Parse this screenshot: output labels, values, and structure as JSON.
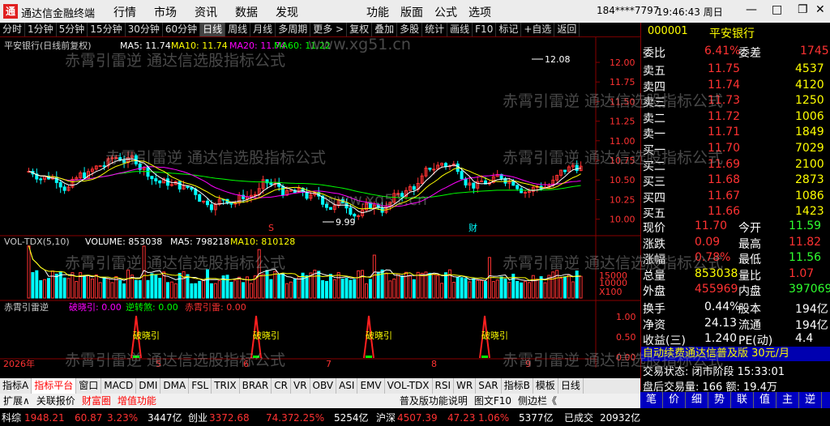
{
  "app": {
    "name": "通达信金融终端",
    "menu1": [
      "行情",
      "市场",
      "资讯",
      "数据",
      "发现"
    ],
    "menu2": [
      "功能",
      "版面",
      "公式",
      "选项"
    ],
    "user": "184****7797",
    "clock": "19:46:43 周日"
  },
  "toolbar": [
    "分时",
    "1分钟",
    "5分钟",
    "15分钟",
    "30分钟",
    "60分钟",
    "日线",
    "周线",
    "月线",
    "多周期",
    "更多 >",
    "复权",
    "叠加",
    "多股",
    "统计",
    "画线",
    "F10",
    "标记",
    "+自选",
    "返回"
  ],
  "chart": {
    "header": {
      "title": "平安银行(日线前复权)",
      "ma5": "MA5: 11.74",
      "ma10": "MA10: 11.74",
      "ma20": "MA20: 11.74",
      "ma60": "MA60: 11.22"
    },
    "price_ticks": [
      "12.00",
      "11.75",
      "11.50",
      "11.25",
      "11.00",
      "10.75",
      "10.50",
      "10.25",
      "10.00"
    ],
    "hi_label": "12.08",
    "lo_label": "9.99",
    "vol_header": {
      "name": "VOL-TDX(5,10)",
      "vol": "VOLUME: 853038",
      "ma5": "MA5: 798218",
      "ma10": "MA10: 810128"
    },
    "vol_ticks": [
      "15000",
      "10000",
      "5000",
      "X100"
    ],
    "ind_header": {
      "name": "赤霄引雷逆",
      "a": "破晓引: 0.00",
      "b": "逆转煞: 0.00",
      "c": "赤霄引雷: 0.00"
    },
    "ind_ticks": [
      "1.00",
      "0.50",
      "0.00"
    ],
    "signal_label": "破晓引",
    "date_labels": [
      "2026年",
      "5",
      "6",
      "7",
      "8",
      "9"
    ],
    "marker_s": "S",
    "marker_cai": "财"
  },
  "chart_data": {
    "type": "candlestick",
    "title": "平安银行(日线前复权)",
    "y_range": [
      9.99,
      12.08
    ],
    "high": 12.08,
    "low": 9.99,
    "ma": {
      "MA5": 11.74,
      "MA10": 11.74,
      "MA20": 11.74,
      "MA60": 11.22
    },
    "volume_last": 853038,
    "vol_ma5": 798218,
    "vol_ma10": 810128
  },
  "bottomtabs": [
    "指标A",
    "指标平台",
    "窗口",
    "MACD",
    "DMI",
    "DMA",
    "FSL",
    "TRIX",
    "BRAR",
    "CR",
    "VR",
    "OBV",
    "ASI",
    "EMV",
    "VOL-TDX",
    "RSI",
    "WR",
    "SAR",
    "指标B",
    "模板",
    "日线"
  ],
  "bottom2": [
    "扩展∧",
    "关联报价",
    "财富圈",
    "增值功能",
    "普及版功能说明",
    "图文F10",
    "侧边栏《"
  ],
  "quote": {
    "code": "000001",
    "name": "平安银行",
    "weibi_l": "委比",
    "weibi": "6.41%",
    "weicha_l": "委差",
    "weicha": "1745",
    "sell": [
      {
        "l": "卖五",
        "p": "11.75",
        "v": "4537"
      },
      {
        "l": "卖四",
        "p": "11.74",
        "v": "4120"
      },
      {
        "l": "卖三",
        "p": "11.73",
        "v": "1250"
      },
      {
        "l": "卖二",
        "p": "11.72",
        "v": "1006"
      },
      {
        "l": "卖一",
        "p": "11.71",
        "v": "1849"
      }
    ],
    "buy": [
      {
        "l": "买一",
        "p": "11.70",
        "v": "7029"
      },
      {
        "l": "买二",
        "p": "11.69",
        "v": "2100"
      },
      {
        "l": "买三",
        "p": "11.68",
        "v": "2873"
      },
      {
        "l": "买四",
        "p": "11.67",
        "v": "1086"
      },
      {
        "l": "买五",
        "p": "11.66",
        "v": "1423"
      }
    ],
    "stats": [
      {
        "l1": "现价",
        "v1": "11.70",
        "l2": "今开",
        "v2": "11.59",
        "c1": "red",
        "c2": "grn"
      },
      {
        "l1": "涨跌",
        "v1": "0.09",
        "l2": "最高",
        "v2": "11.82",
        "c1": "red",
        "c2": "red"
      },
      {
        "l1": "涨幅",
        "v1": "0.78%",
        "l2": "最低",
        "v2": "11.56",
        "c1": "red",
        "c2": "grn"
      },
      {
        "l1": "总量",
        "v1": "853038",
        "l2": "量比",
        "v2": "1.07",
        "c1": "yel",
        "c2": "red"
      },
      {
        "l1": "外盘",
        "v1": "455969",
        "l2": "内盘",
        "v2": "397069",
        "c1": "red",
        "c2": "grn"
      }
    ],
    "stats2": [
      {
        "l1": "换手",
        "v1": "0.44%",
        "l2": "股本",
        "v2": "194亿"
      },
      {
        "l1": "净资",
        "v1": "24.13",
        "l2": "流通",
        "v2": "194亿"
      },
      {
        "l1": "收益(三)",
        "v1": "1.240",
        "l2": "PE(动)",
        "v2": "4.4"
      }
    ],
    "promo": "自动续费通达信普及版 30元/月",
    "trade_state": "交易状态: 闭市阶段 15:33:01",
    "after": "盘后交易量: 166 额: 19.4万",
    "btns": [
      "笔",
      "价",
      "细",
      "势",
      "联",
      "值",
      "主",
      "逆"
    ]
  },
  "status": [
    {
      "t": "科综",
      "c": "wht"
    },
    {
      "t": "1948.21",
      "c": "red"
    },
    {
      "t": "60.87",
      "c": "red"
    },
    {
      "t": "3.23%",
      "c": "red"
    },
    {
      "t": "3447亿",
      "c": "wht"
    },
    {
      "t": "创业",
      "c": "wht"
    },
    {
      "t": "3372.68",
      "c": "red"
    },
    {
      "t": "74.37",
      "c": "red"
    },
    {
      "t": "2.25%",
      "c": "red"
    },
    {
      "t": "5254亿",
      "c": "wht"
    },
    {
      "t": "沪深",
      "c": "wht"
    },
    {
      "t": "4507.39",
      "c": "red"
    },
    {
      "t": "47.23",
      "c": "red"
    },
    {
      "t": "1.06%",
      "c": "red"
    },
    {
      "t": "5377亿",
      "c": "wht"
    },
    {
      "t": "已成交",
      "c": "wht"
    },
    {
      "t": "20932亿",
      "c": "wht"
    }
  ],
  "watermark": {
    "a": "赤霄引雷逆 通达信选股指标公式",
    "b": "www.xg51.cn"
  }
}
